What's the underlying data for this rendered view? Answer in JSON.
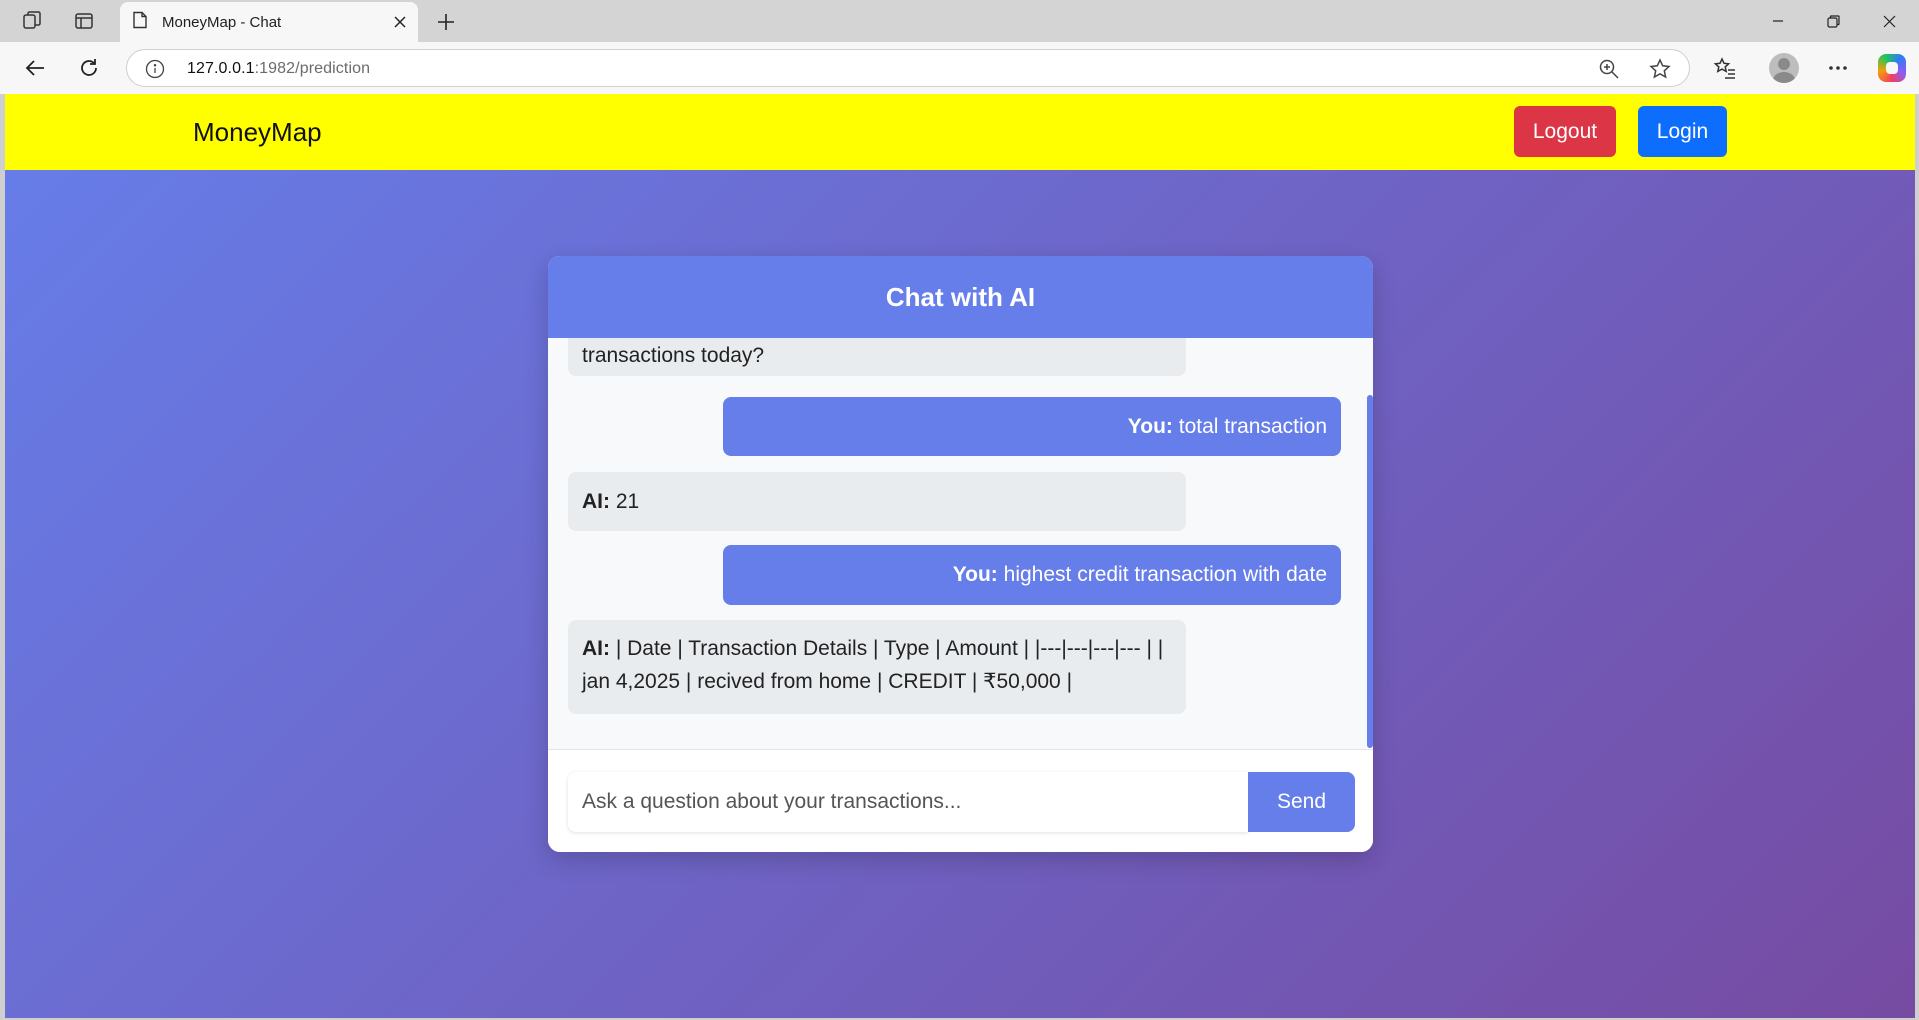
{
  "browser": {
    "tab_title": "MoneyMap - Chat",
    "url_host": "127.0.0.1",
    "url_path": ":1982/prediction"
  },
  "navbar": {
    "brand": "MoneyMap",
    "logout_label": "Logout",
    "login_label": "Login",
    "colors": {
      "background": "#ffff00",
      "logout": "#dc3545",
      "login": "#0d6efd"
    }
  },
  "chat": {
    "title": "Chat with AI",
    "accent_color": "#667eea",
    "messages": [
      {
        "sender": "ai",
        "prefix": "",
        "text": "transactions today?"
      },
      {
        "sender": "user",
        "prefix": "You:",
        "text": " total transaction"
      },
      {
        "sender": "ai",
        "prefix": "AI:",
        "text": " 21"
      },
      {
        "sender": "user",
        "prefix": "You:",
        "text": " highest credit transaction with date"
      },
      {
        "sender": "ai",
        "prefix": "AI:",
        "text": " | Date | Transaction Details | Type | Amount | |---|---|---|--- | | jan 4,2025 | recived from home | CREDIT | ₹50,000 |"
      }
    ],
    "input_placeholder": "Ask a question about your transactions...",
    "send_label": "Send"
  }
}
